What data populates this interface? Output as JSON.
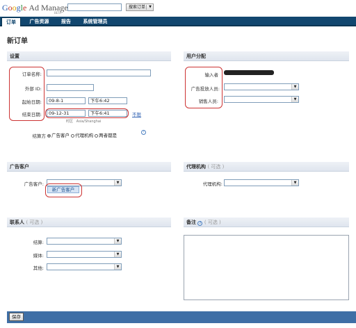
{
  "header": {
    "logo": {
      "g1": "G",
      "g2": "o",
      "g3": "o",
      "g4": "g",
      "g5": "l",
      "g6": "e",
      "suffix": "Ad Manager"
    },
    "beta": "BETA",
    "search_button": "搜索订单",
    "search_arrow": "▼"
  },
  "nav": {
    "tabs": [
      "订单",
      "广告资源",
      "报告",
      "系统管理员"
    ]
  },
  "page_title": "新订单",
  "settings": {
    "heading": "设置",
    "order_name_label": "订单名称:",
    "external_id_label": "外部 ID:",
    "start_date_label": "起始日期:",
    "start_date": "09-8-1",
    "start_time": "下午6:42",
    "end_date_label": "结束日期:",
    "end_date": "09-12-31",
    "end_time": "下午6:41",
    "unlimited_link": "不限",
    "timezone_label": "时区",
    "timezone": "Asia/Shanghai",
    "settlement_label": "结算方",
    "settlement_options": [
      "广告客户",
      "代理机构",
      "两者都是"
    ],
    "settlement_selected": "广告客户",
    "help_glyph": "?"
  },
  "user_assignment": {
    "heading": "用户分配",
    "input_by_label": "输入者",
    "ad_trafficker_label": "广告投放人员:",
    "salesperson_label": "销售人员:"
  },
  "advertiser": {
    "heading": "广告客户",
    "advertiser_label": "广告客户:",
    "new_advertiser_button": "新广告客户"
  },
  "agency": {
    "heading": "代理机构",
    "optional": "( 可选 )",
    "agency_label": "代理机构:"
  },
  "contacts": {
    "heading": "联系人",
    "optional": "( 可选 )",
    "settlement_label": "结算:",
    "media_label": "媒体:",
    "other_label": "其他:"
  },
  "notes": {
    "heading": "备注",
    "optional": "( 可选 )",
    "help_glyph": "?"
  },
  "footer": {
    "save_button": "保存"
  },
  "icons": {
    "dropdown": "chevron-down-icon",
    "help": "help-icon"
  },
  "colors": {
    "nav": "#12476f",
    "panel_header": "#e4e9f0",
    "footer": "#3f6fa6",
    "annotation": "#cc3333"
  }
}
